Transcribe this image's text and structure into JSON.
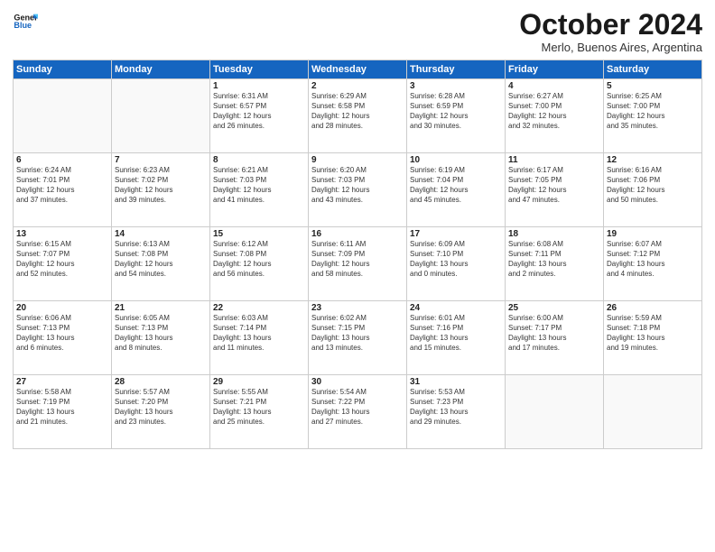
{
  "header": {
    "logo_line1": "General",
    "logo_line2": "Blue",
    "month": "October 2024",
    "location": "Merlo, Buenos Aires, Argentina"
  },
  "weekdays": [
    "Sunday",
    "Monday",
    "Tuesday",
    "Wednesday",
    "Thursday",
    "Friday",
    "Saturday"
  ],
  "weeks": [
    [
      {
        "day": "",
        "info": ""
      },
      {
        "day": "",
        "info": ""
      },
      {
        "day": "1",
        "info": "Sunrise: 6:31 AM\nSunset: 6:57 PM\nDaylight: 12 hours\nand 26 minutes."
      },
      {
        "day": "2",
        "info": "Sunrise: 6:29 AM\nSunset: 6:58 PM\nDaylight: 12 hours\nand 28 minutes."
      },
      {
        "day": "3",
        "info": "Sunrise: 6:28 AM\nSunset: 6:59 PM\nDaylight: 12 hours\nand 30 minutes."
      },
      {
        "day": "4",
        "info": "Sunrise: 6:27 AM\nSunset: 7:00 PM\nDaylight: 12 hours\nand 32 minutes."
      },
      {
        "day": "5",
        "info": "Sunrise: 6:25 AM\nSunset: 7:00 PM\nDaylight: 12 hours\nand 35 minutes."
      }
    ],
    [
      {
        "day": "6",
        "info": "Sunrise: 6:24 AM\nSunset: 7:01 PM\nDaylight: 12 hours\nand 37 minutes."
      },
      {
        "day": "7",
        "info": "Sunrise: 6:23 AM\nSunset: 7:02 PM\nDaylight: 12 hours\nand 39 minutes."
      },
      {
        "day": "8",
        "info": "Sunrise: 6:21 AM\nSunset: 7:03 PM\nDaylight: 12 hours\nand 41 minutes."
      },
      {
        "day": "9",
        "info": "Sunrise: 6:20 AM\nSunset: 7:03 PM\nDaylight: 12 hours\nand 43 minutes."
      },
      {
        "day": "10",
        "info": "Sunrise: 6:19 AM\nSunset: 7:04 PM\nDaylight: 12 hours\nand 45 minutes."
      },
      {
        "day": "11",
        "info": "Sunrise: 6:17 AM\nSunset: 7:05 PM\nDaylight: 12 hours\nand 47 minutes."
      },
      {
        "day": "12",
        "info": "Sunrise: 6:16 AM\nSunset: 7:06 PM\nDaylight: 12 hours\nand 50 minutes."
      }
    ],
    [
      {
        "day": "13",
        "info": "Sunrise: 6:15 AM\nSunset: 7:07 PM\nDaylight: 12 hours\nand 52 minutes."
      },
      {
        "day": "14",
        "info": "Sunrise: 6:13 AM\nSunset: 7:08 PM\nDaylight: 12 hours\nand 54 minutes."
      },
      {
        "day": "15",
        "info": "Sunrise: 6:12 AM\nSunset: 7:08 PM\nDaylight: 12 hours\nand 56 minutes."
      },
      {
        "day": "16",
        "info": "Sunrise: 6:11 AM\nSunset: 7:09 PM\nDaylight: 12 hours\nand 58 minutes."
      },
      {
        "day": "17",
        "info": "Sunrise: 6:09 AM\nSunset: 7:10 PM\nDaylight: 13 hours\nand 0 minutes."
      },
      {
        "day": "18",
        "info": "Sunrise: 6:08 AM\nSunset: 7:11 PM\nDaylight: 13 hours\nand 2 minutes."
      },
      {
        "day": "19",
        "info": "Sunrise: 6:07 AM\nSunset: 7:12 PM\nDaylight: 13 hours\nand 4 minutes."
      }
    ],
    [
      {
        "day": "20",
        "info": "Sunrise: 6:06 AM\nSunset: 7:13 PM\nDaylight: 13 hours\nand 6 minutes."
      },
      {
        "day": "21",
        "info": "Sunrise: 6:05 AM\nSunset: 7:13 PM\nDaylight: 13 hours\nand 8 minutes."
      },
      {
        "day": "22",
        "info": "Sunrise: 6:03 AM\nSunset: 7:14 PM\nDaylight: 13 hours\nand 11 minutes."
      },
      {
        "day": "23",
        "info": "Sunrise: 6:02 AM\nSunset: 7:15 PM\nDaylight: 13 hours\nand 13 minutes."
      },
      {
        "day": "24",
        "info": "Sunrise: 6:01 AM\nSunset: 7:16 PM\nDaylight: 13 hours\nand 15 minutes."
      },
      {
        "day": "25",
        "info": "Sunrise: 6:00 AM\nSunset: 7:17 PM\nDaylight: 13 hours\nand 17 minutes."
      },
      {
        "day": "26",
        "info": "Sunrise: 5:59 AM\nSunset: 7:18 PM\nDaylight: 13 hours\nand 19 minutes."
      }
    ],
    [
      {
        "day": "27",
        "info": "Sunrise: 5:58 AM\nSunset: 7:19 PM\nDaylight: 13 hours\nand 21 minutes."
      },
      {
        "day": "28",
        "info": "Sunrise: 5:57 AM\nSunset: 7:20 PM\nDaylight: 13 hours\nand 23 minutes."
      },
      {
        "day": "29",
        "info": "Sunrise: 5:55 AM\nSunset: 7:21 PM\nDaylight: 13 hours\nand 25 minutes."
      },
      {
        "day": "30",
        "info": "Sunrise: 5:54 AM\nSunset: 7:22 PM\nDaylight: 13 hours\nand 27 minutes."
      },
      {
        "day": "31",
        "info": "Sunrise: 5:53 AM\nSunset: 7:23 PM\nDaylight: 13 hours\nand 29 minutes."
      },
      {
        "day": "",
        "info": ""
      },
      {
        "day": "",
        "info": ""
      }
    ]
  ]
}
